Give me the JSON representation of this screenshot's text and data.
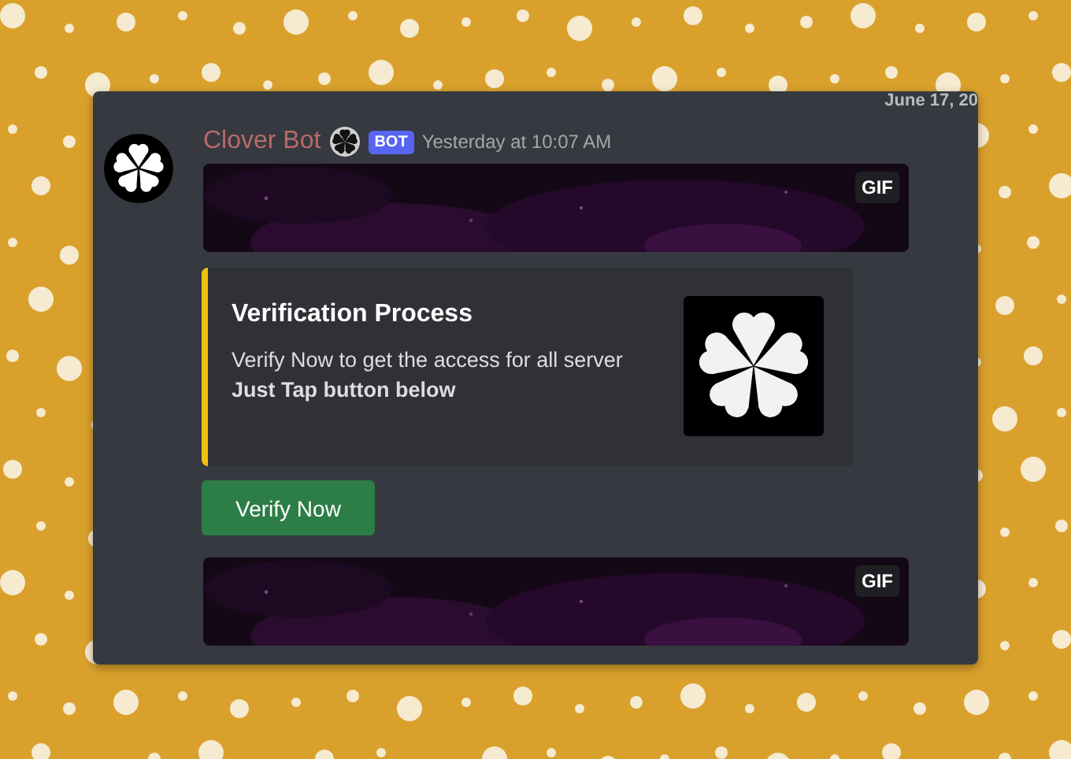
{
  "date_divider": "June 17, 20",
  "message": {
    "author": "Clover Bot",
    "badge": "BOT",
    "timestamp": "Yesterday at 10:07 AM",
    "blocks": [
      {
        "kind": "gif",
        "label": "GIF"
      },
      {
        "kind": "embed",
        "title": "Verification Process",
        "description": "Verify Now to get the access for all server\n**Just Tap button below**"
      },
      {
        "kind": "button",
        "label": "Verify Now"
      },
      {
        "kind": "gif",
        "label": "GIF"
      }
    ]
  }
}
